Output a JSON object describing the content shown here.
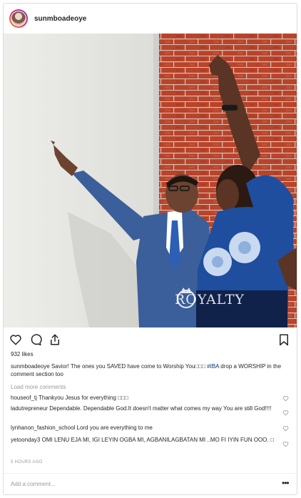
{
  "post": {
    "username": "sunmboadeoye",
    "likes": "932 likes",
    "caption": {
      "username": "sunmboadeoye",
      "text": "Savior! The ones you SAVED have come to Worship You□□□",
      "hashtag": "#IBA",
      "text_after": "drop a WORSHIP in the comment section too"
    },
    "load_more": "Load more comments",
    "comments": [
      {
        "username": "houseof_tj",
        "text": "Thankyou Jesus for everything □□□"
      },
      {
        "username": "ladutrepreneur",
        "text": "Dependable. Dependable God.It doesn't matter what comes my way You are still God!!!!"
      },
      {
        "username": "lynhanon_fashion_school",
        "text": "Lord you are everything to me"
      },
      {
        "username": "yetoonday3",
        "text": "OMI LENU EJA MI, IGI LEYIN OGBA MI, AGBANILAGBATAN MI ..MO FI IYIN FUN OOO. □"
      }
    ],
    "timestamp": "5 HOURS AGO",
    "add_comment_placeholder": "Add a comment...",
    "more_label": "•••",
    "watermark": "ROYALTY"
  },
  "icons": [
    "heart-icon",
    "comment-icon",
    "share-icon",
    "bookmark-icon",
    "more-options-icon"
  ],
  "colors": {
    "hashtag": "#003569",
    "muted": "#999999",
    "text": "#262626",
    "suit": "#3b5f9a",
    "blouse": "#1f4e9e",
    "brick": "#b8442b"
  }
}
